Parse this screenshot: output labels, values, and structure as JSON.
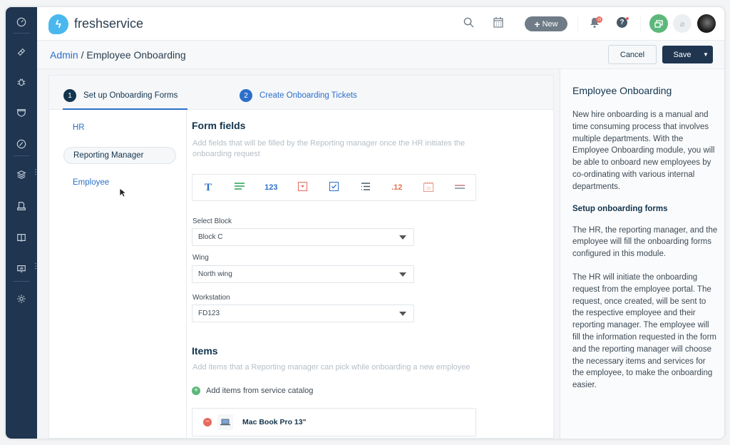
{
  "app": {
    "brand": "freshservice",
    "logo_icon": "bolt-icon"
  },
  "sidebar": {
    "items": [
      {
        "name": "dashboard",
        "icon": "speedometer-icon"
      },
      {
        "name": "tickets",
        "icon": "ticket-icon"
      },
      {
        "name": "problems",
        "icon": "bug-icon"
      },
      {
        "name": "changes",
        "icon": "shield-icon"
      },
      {
        "name": "releases",
        "icon": "rocket-icon"
      },
      {
        "name": "assets",
        "icon": "layers-icon",
        "has_more": true
      },
      {
        "name": "contracts",
        "icon": "document-icon"
      },
      {
        "name": "solutions",
        "icon": "book-icon"
      },
      {
        "name": "reports",
        "icon": "presentation-icon",
        "has_more": true
      },
      {
        "name": "admin",
        "icon": "gear-icon"
      }
    ],
    "more_glyph": "⋮"
  },
  "topbar": {
    "new_label": "New",
    "new_plus": "+",
    "notification_count": "15",
    "help_glyph": "?"
  },
  "breadcrumb": {
    "root": "Admin",
    "separator": "/",
    "current": "Employee Onboarding"
  },
  "actions": {
    "cancel": "Cancel",
    "save": "Save",
    "save_caret": "▼"
  },
  "steps": [
    {
      "number": "1",
      "label": "Set up Onboarding Forms",
      "active": true
    },
    {
      "number": "2",
      "label": "Create Onboarding Tickets",
      "active": false
    }
  ],
  "roles": [
    {
      "label": "HR",
      "active": false
    },
    {
      "label": "Reporting Manager",
      "active": true
    },
    {
      "label": "Employee",
      "active": false
    }
  ],
  "form_fields": {
    "title": "Form fields",
    "hint": "Add fields that will be filled by the Reporting manager once the HR initiates the onboarding request",
    "palette": [
      {
        "type": "single-line-text",
        "glyph": "T",
        "color": "#2c6fc9"
      },
      {
        "type": "paragraph",
        "glyph": "≡",
        "color": "#5cb87a"
      },
      {
        "type": "number",
        "glyph": "123",
        "color": "#2c6fc9"
      },
      {
        "type": "dropdown",
        "glyph": "▾",
        "color": "#e86a5f"
      },
      {
        "type": "checkbox",
        "glyph": "✓",
        "color": "#2c6fc9"
      },
      {
        "type": "multi-choice",
        "glyph": "☰",
        "color": "#475867"
      },
      {
        "type": "decimal",
        "glyph": ".12",
        "color": "#e8704f"
      },
      {
        "type": "date",
        "glyph": "23",
        "color": "#e89a8a"
      },
      {
        "type": "divider",
        "glyph": "═",
        "color": "#c47a80"
      }
    ],
    "fields": [
      {
        "label": "Select Block",
        "value": "Block C"
      },
      {
        "label": "Wing",
        "value": "North wing"
      },
      {
        "label": "Workstation",
        "value": "FD123"
      }
    ]
  },
  "items": {
    "title": "Items",
    "hint": "Add items that a Reporting manager can pick while onboarding a new employee",
    "add_label": "Add items from service catalog",
    "list": [
      {
        "name": "Mac Book Pro 13\""
      }
    ]
  },
  "help": {
    "title": "Employee Onboarding",
    "intro": "New hire onboarding is a manual and time consuming process that involves multiple departments. With the Employee Onboarding module, you will be able to onboard new employees by co-ordinating with various internal departments.",
    "subheading": "Setup onboarding forms",
    "p1": "The HR, the reporting manager, and the employee will fill the onboarding forms configured in this module.",
    "p2": "The HR will initiate the onboarding request from the employee portal. The request, once created, will be sent to the respective employee and their reporting manager. The employee will fill the information requested in the form and the reporting manager will choose the necessary items and services for the employee, to make the onboarding easier."
  },
  "colors": {
    "accent": "#2c6fc9",
    "sidebar": "#1f3550",
    "success": "#5cb87a",
    "danger": "#e86a5f"
  }
}
